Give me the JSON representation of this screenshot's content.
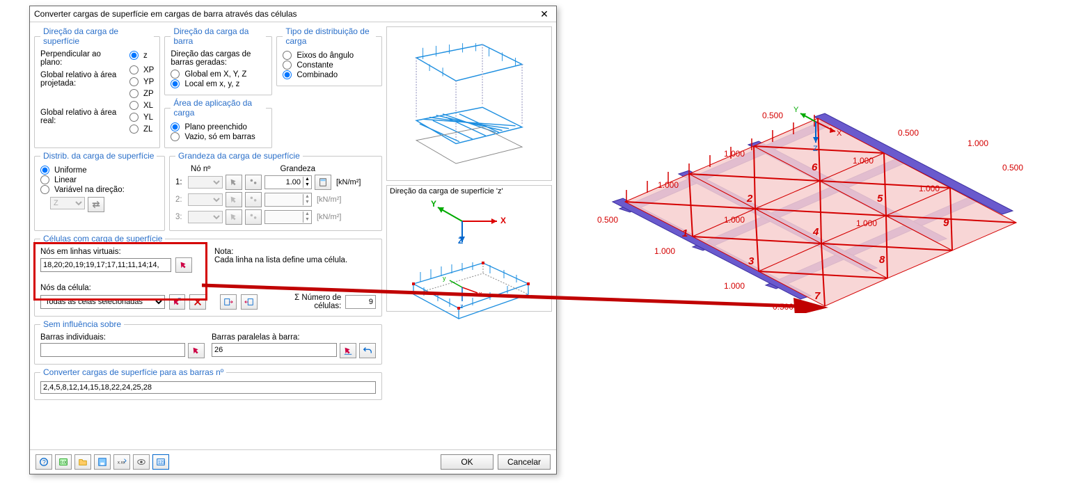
{
  "window": {
    "title": "Converter cargas de superfície em cargas de barra através das células"
  },
  "groups": {
    "dir_superficie": "Direção da carga de superfície",
    "dir_barra": "Direção da carga da barra",
    "tipo_dist": "Tipo de distribuição de carga",
    "area_aplic": "Área de aplicação da carga",
    "dist_carga": "Distrib. da carga de superfície",
    "grandeza": "Grandeza da carga de superfície",
    "celulas": "Células com carga de superfície",
    "sem_infl": "Sem influência sobre",
    "converter": "Converter cargas de superfície para as barras nº"
  },
  "dir_superficie": {
    "perp_label": "Perpendicular ao plano:",
    "perp_opt": "z",
    "proj_label": "Global relativo à área projetada:",
    "proj_opts": [
      "XP",
      "YP",
      "ZP"
    ],
    "real_label": "Global relativo à área real:",
    "real_opts": [
      "XL",
      "YL",
      "ZL"
    ]
  },
  "dir_barra": {
    "caption": "Direção das cargas de barras geradas:",
    "opt1": "Global em X, Y, Z",
    "opt2": "Local em x, y, z"
  },
  "tipo_dist": {
    "opt1": "Eixos do ângulo",
    "opt2": "Constante",
    "opt3": "Combinado"
  },
  "area_aplic": {
    "opt1": "Plano preenchido",
    "opt2": "Vazio, só em barras"
  },
  "dist_carga": {
    "opt1": "Uniforme",
    "opt2": "Linear",
    "opt3": "Variável na direção:",
    "axis": "Z"
  },
  "grandeza": {
    "no_hdr": "Nó nº",
    "grand_hdr": "Grandeza",
    "rows": [
      "1:",
      "2:",
      "3:"
    ],
    "value1": "1.00",
    "unit": "[kN/m²]"
  },
  "celulas": {
    "label": "Nós em linhas virtuais:",
    "value": "18,20;20,19;19,17;17,11;11,14;14,",
    "nota_label": "Nota:",
    "nota_text": "Cada linha na lista define uma célula.",
    "nos_label": "Nós da célula:",
    "dropdown": "Todas as celas selecionadas",
    "sigma_label": "Σ Número de células:",
    "sigma_value": "9"
  },
  "sem_infl": {
    "barras_ind": "Barras individuais:",
    "barras_par": "Barras paralelas à barra:",
    "par_value": "26"
  },
  "converter": {
    "value": "2,4,5,8,12,14,15,18,22,24,25,28"
  },
  "preview2_caption": "Direção da carga de superfície 'z'",
  "footer": {
    "ok": "OK",
    "cancel": "Cancelar"
  },
  "model": {
    "dims": {
      "d0500": "0.500",
      "d1000": "1.000"
    },
    "cells": [
      "1",
      "2",
      "3",
      "4",
      "5",
      "6",
      "7",
      "8",
      "9"
    ]
  }
}
